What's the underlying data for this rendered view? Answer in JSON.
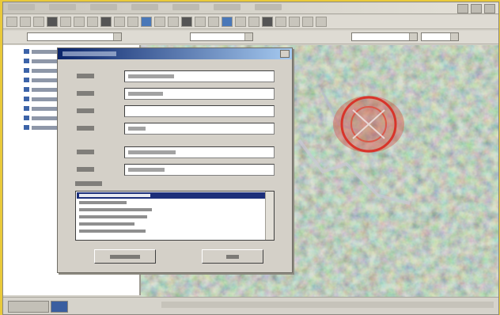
{
  "app": {
    "title": "",
    "menus": [
      "",
      "",
      "",
      "",
      "",
      "",
      ""
    ]
  },
  "toolbar": {
    "layer_combo_value": "",
    "scale_combo_value": ""
  },
  "layers": [
    "",
    "",
    "",
    "",
    "",
    "",
    "",
    "",
    ""
  ],
  "dialog": {
    "title": "",
    "fields": [
      {
        "label": "",
        "value": ""
      },
      {
        "label": "",
        "value": ""
      },
      {
        "label": "",
        "value": ""
      },
      {
        "label": "",
        "value": ""
      },
      {
        "label": "",
        "value": ""
      },
      {
        "label": "",
        "value": ""
      }
    ],
    "list_label": "",
    "list_items": [
      "",
      "",
      "",
      "",
      "",
      ""
    ],
    "selected_index": 0,
    "ok_label": "",
    "cancel_label": ""
  },
  "map": {
    "marker_color": "#d8342a"
  },
  "colors": {
    "dialog_title": "#0a246a",
    "selection": "#1c2f7a",
    "frame": "#e9c93a"
  }
}
